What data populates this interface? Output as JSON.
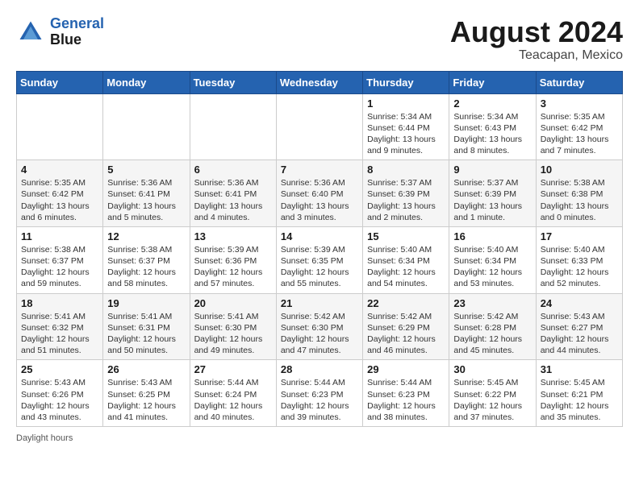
{
  "header": {
    "logo_line1": "General",
    "logo_line2": "Blue",
    "month_year": "August 2024",
    "location": "Teacapan, Mexico"
  },
  "days_of_week": [
    "Sunday",
    "Monday",
    "Tuesday",
    "Wednesday",
    "Thursday",
    "Friday",
    "Saturday"
  ],
  "weeks": [
    [
      {
        "day": "",
        "sunrise": "",
        "sunset": "",
        "daylight": ""
      },
      {
        "day": "",
        "sunrise": "",
        "sunset": "",
        "daylight": ""
      },
      {
        "day": "",
        "sunrise": "",
        "sunset": "",
        "daylight": ""
      },
      {
        "day": "",
        "sunrise": "",
        "sunset": "",
        "daylight": ""
      },
      {
        "day": "1",
        "sunrise": "Sunrise: 5:34 AM",
        "sunset": "Sunset: 6:44 PM",
        "daylight": "Daylight: 13 hours and 9 minutes."
      },
      {
        "day": "2",
        "sunrise": "Sunrise: 5:34 AM",
        "sunset": "Sunset: 6:43 PM",
        "daylight": "Daylight: 13 hours and 8 minutes."
      },
      {
        "day": "3",
        "sunrise": "Sunrise: 5:35 AM",
        "sunset": "Sunset: 6:42 PM",
        "daylight": "Daylight: 13 hours and 7 minutes."
      }
    ],
    [
      {
        "day": "4",
        "sunrise": "Sunrise: 5:35 AM",
        "sunset": "Sunset: 6:42 PM",
        "daylight": "Daylight: 13 hours and 6 minutes."
      },
      {
        "day": "5",
        "sunrise": "Sunrise: 5:36 AM",
        "sunset": "Sunset: 6:41 PM",
        "daylight": "Daylight: 13 hours and 5 minutes."
      },
      {
        "day": "6",
        "sunrise": "Sunrise: 5:36 AM",
        "sunset": "Sunset: 6:41 PM",
        "daylight": "Daylight: 13 hours and 4 minutes."
      },
      {
        "day": "7",
        "sunrise": "Sunrise: 5:36 AM",
        "sunset": "Sunset: 6:40 PM",
        "daylight": "Daylight: 13 hours and 3 minutes."
      },
      {
        "day": "8",
        "sunrise": "Sunrise: 5:37 AM",
        "sunset": "Sunset: 6:39 PM",
        "daylight": "Daylight: 13 hours and 2 minutes."
      },
      {
        "day": "9",
        "sunrise": "Sunrise: 5:37 AM",
        "sunset": "Sunset: 6:39 PM",
        "daylight": "Daylight: 13 hours and 1 minute."
      },
      {
        "day": "10",
        "sunrise": "Sunrise: 5:38 AM",
        "sunset": "Sunset: 6:38 PM",
        "daylight": "Daylight: 13 hours and 0 minutes."
      }
    ],
    [
      {
        "day": "11",
        "sunrise": "Sunrise: 5:38 AM",
        "sunset": "Sunset: 6:37 PM",
        "daylight": "Daylight: 12 hours and 59 minutes."
      },
      {
        "day": "12",
        "sunrise": "Sunrise: 5:38 AM",
        "sunset": "Sunset: 6:37 PM",
        "daylight": "Daylight: 12 hours and 58 minutes."
      },
      {
        "day": "13",
        "sunrise": "Sunrise: 5:39 AM",
        "sunset": "Sunset: 6:36 PM",
        "daylight": "Daylight: 12 hours and 57 minutes."
      },
      {
        "day": "14",
        "sunrise": "Sunrise: 5:39 AM",
        "sunset": "Sunset: 6:35 PM",
        "daylight": "Daylight: 12 hours and 55 minutes."
      },
      {
        "day": "15",
        "sunrise": "Sunrise: 5:40 AM",
        "sunset": "Sunset: 6:34 PM",
        "daylight": "Daylight: 12 hours and 54 minutes."
      },
      {
        "day": "16",
        "sunrise": "Sunrise: 5:40 AM",
        "sunset": "Sunset: 6:34 PM",
        "daylight": "Daylight: 12 hours and 53 minutes."
      },
      {
        "day": "17",
        "sunrise": "Sunrise: 5:40 AM",
        "sunset": "Sunset: 6:33 PM",
        "daylight": "Daylight: 12 hours and 52 minutes."
      }
    ],
    [
      {
        "day": "18",
        "sunrise": "Sunrise: 5:41 AM",
        "sunset": "Sunset: 6:32 PM",
        "daylight": "Daylight: 12 hours and 51 minutes."
      },
      {
        "day": "19",
        "sunrise": "Sunrise: 5:41 AM",
        "sunset": "Sunset: 6:31 PM",
        "daylight": "Daylight: 12 hours and 50 minutes."
      },
      {
        "day": "20",
        "sunrise": "Sunrise: 5:41 AM",
        "sunset": "Sunset: 6:30 PM",
        "daylight": "Daylight: 12 hours and 49 minutes."
      },
      {
        "day": "21",
        "sunrise": "Sunrise: 5:42 AM",
        "sunset": "Sunset: 6:30 PM",
        "daylight": "Daylight: 12 hours and 47 minutes."
      },
      {
        "day": "22",
        "sunrise": "Sunrise: 5:42 AM",
        "sunset": "Sunset: 6:29 PM",
        "daylight": "Daylight: 12 hours and 46 minutes."
      },
      {
        "day": "23",
        "sunrise": "Sunrise: 5:42 AM",
        "sunset": "Sunset: 6:28 PM",
        "daylight": "Daylight: 12 hours and 45 minutes."
      },
      {
        "day": "24",
        "sunrise": "Sunrise: 5:43 AM",
        "sunset": "Sunset: 6:27 PM",
        "daylight": "Daylight: 12 hours and 44 minutes."
      }
    ],
    [
      {
        "day": "25",
        "sunrise": "Sunrise: 5:43 AM",
        "sunset": "Sunset: 6:26 PM",
        "daylight": "Daylight: 12 hours and 43 minutes."
      },
      {
        "day": "26",
        "sunrise": "Sunrise: 5:43 AM",
        "sunset": "Sunset: 6:25 PM",
        "daylight": "Daylight: 12 hours and 41 minutes."
      },
      {
        "day": "27",
        "sunrise": "Sunrise: 5:44 AM",
        "sunset": "Sunset: 6:24 PM",
        "daylight": "Daylight: 12 hours and 40 minutes."
      },
      {
        "day": "28",
        "sunrise": "Sunrise: 5:44 AM",
        "sunset": "Sunset: 6:23 PM",
        "daylight": "Daylight: 12 hours and 39 minutes."
      },
      {
        "day": "29",
        "sunrise": "Sunrise: 5:44 AM",
        "sunset": "Sunset: 6:23 PM",
        "daylight": "Daylight: 12 hours and 38 minutes."
      },
      {
        "day": "30",
        "sunrise": "Sunrise: 5:45 AM",
        "sunset": "Sunset: 6:22 PM",
        "daylight": "Daylight: 12 hours and 37 minutes."
      },
      {
        "day": "31",
        "sunrise": "Sunrise: 5:45 AM",
        "sunset": "Sunset: 6:21 PM",
        "daylight": "Daylight: 12 hours and 35 minutes."
      }
    ]
  ],
  "footer": {
    "daylight_label": "Daylight hours"
  }
}
